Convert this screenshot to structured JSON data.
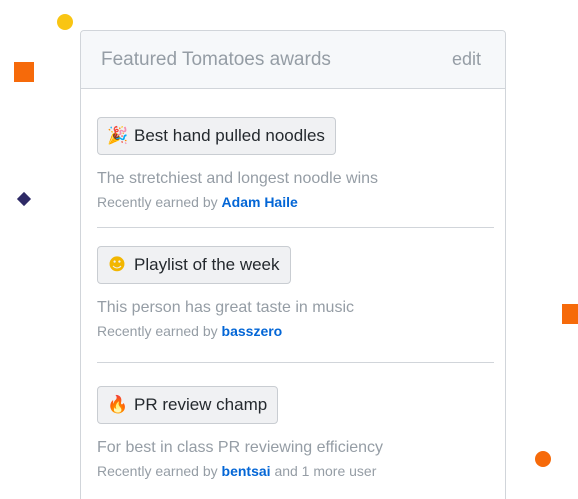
{
  "card": {
    "title": "Featured Tomatoes awards",
    "edit_label": "edit"
  },
  "awards": [
    {
      "icon": "party-popper-icon",
      "emoji": "🎉",
      "name": "Best hand pulled noodles",
      "description": "The stretchiest and longest noodle wins",
      "earned_prefix": "Recently earned by",
      "user": "Adam Haile",
      "suffix": ""
    },
    {
      "icon": "smiley-icon",
      "emoji": "☻",
      "name": "Playlist of the week",
      "description": "This person has great taste in music",
      "earned_prefix": "Recently earned by",
      "user": "basszero",
      "suffix": ""
    },
    {
      "icon": "fire-icon",
      "emoji": "🔥",
      "name": "PR review champ",
      "description": "For best in class PR reviewing efficiency",
      "earned_prefix": "Recently earned by",
      "user": "bentsai",
      "suffix": "and 1 more user"
    }
  ],
  "colors": {
    "link": "#0366d6",
    "muted": "#959da5",
    "decor_yellow": "#f9c513",
    "decor_orange": "#f66a0a",
    "decor_navy": "#2e2a66",
    "emoji_smiley": "#f2b600",
    "emoji_fire": "#e8452c",
    "emoji_party": "#f5a623"
  }
}
